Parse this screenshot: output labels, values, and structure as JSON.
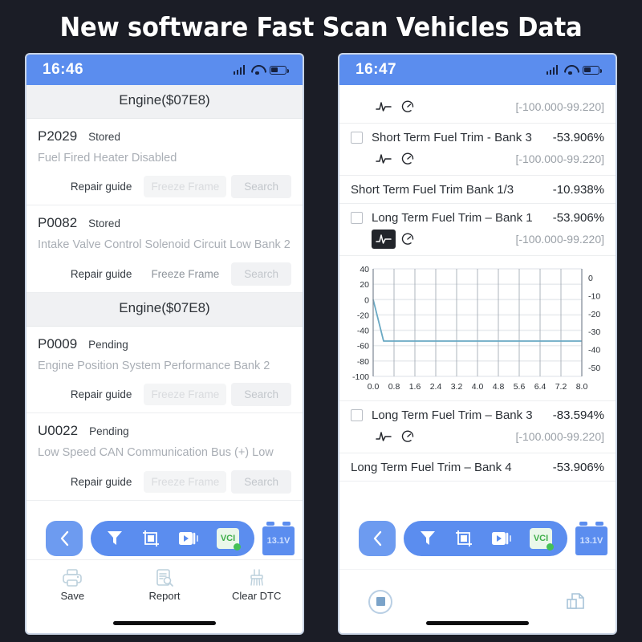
{
  "banner": {
    "title": "New software Fast Scan Vehicles Data"
  },
  "left_phone": {
    "statusbar": {
      "time": "16:46",
      "signal_icon": "signal-bars-icon",
      "wifi_icon": "wifi-icon",
      "battery_icon": "battery-icon"
    },
    "sections": [
      {
        "header": "Engine($07E8)",
        "codes": [
          {
            "code": "P2029",
            "state": "Stored",
            "description": "Fuel Fired Heater Disabled",
            "repair_label": "Repair guide",
            "freeze_label": "Freeze Frame",
            "search_label": "Search",
            "freeze_enabled": false
          },
          {
            "code": "P0082",
            "state": "Stored",
            "description": "Intake Valve Control Solenoid Circuit Low Bank 2",
            "repair_label": "Repair guide",
            "freeze_label": "Freeze Frame",
            "search_label": "Search",
            "freeze_enabled": true
          }
        ]
      },
      {
        "header": "Engine($07E8)",
        "codes": [
          {
            "code": "P0009",
            "state": "Pending",
            "description": "Engine Position System Performance Bank 2",
            "repair_label": "Repair guide",
            "freeze_label": "Freeze Frame",
            "search_label": "Search",
            "freeze_enabled": false
          },
          {
            "code": "U0022",
            "state": "Pending",
            "description": "Low Speed CAN Communication Bus (+) Low",
            "repair_label": "Repair guide",
            "freeze_label": "Freeze Frame",
            "search_label": "Search",
            "freeze_enabled": false
          }
        ]
      }
    ],
    "bottom_bar": [
      {
        "label": "Save",
        "icon": "printer-icon"
      },
      {
        "label": "Report",
        "icon": "report-search-icon"
      },
      {
        "label": "Clear DTC",
        "icon": "broom-icon"
      }
    ],
    "floating_toolbar": {
      "back_icon": "chevron-left-icon",
      "tools": [
        "filter-icon",
        "screenshot-crop-icon",
        "video-record-icon",
        "vci-icon"
      ],
      "vci_label": "VCI",
      "battery_voltage": "13.1V"
    }
  },
  "right_phone": {
    "statusbar": {
      "time": "16:47",
      "signal_icon": "signal-bars-icon",
      "wifi_icon": "wifi-icon",
      "battery_icon": "battery-icon"
    },
    "partial_top_row": {
      "range": "[-100.000-99.220]",
      "wave_icon": "waveform-icon",
      "gauge_icon": "gauge-icon"
    },
    "rows": [
      {
        "name": "Short Term Fuel Trim - Bank 3",
        "value": "-53.906%",
        "range": "[-100.000-99.220]",
        "checkbox": true,
        "wave_active": false,
        "wave_icon": "waveform-icon",
        "gauge_icon": "gauge-icon"
      },
      {
        "name": "Short Term Fuel Trim Bank 1/3",
        "value": "-10.938%",
        "range": "",
        "checkbox": false,
        "wave_active": false
      },
      {
        "name": "Long Term Fuel Trim – Bank 1",
        "value": "-53.906%",
        "range": "[-100.000-99.220]",
        "checkbox": true,
        "wave_active": true,
        "wave_icon": "waveform-icon",
        "gauge_icon": "gauge-icon"
      },
      {
        "name": "Long Term Fuel Trim – Bank 3",
        "value": "-83.594%",
        "range": "[-100.000-99.220]",
        "checkbox": true,
        "wave_active": false,
        "wave_icon": "waveform-icon",
        "gauge_icon": "gauge-icon"
      },
      {
        "name": "Long Term Fuel Trim – Bank 4",
        "value": "-53.906%",
        "range": "",
        "checkbox": false,
        "wave_active": false
      }
    ],
    "bottom_bar": {
      "stop_icon": "stop-record-icon",
      "report_icon": "report-file-icon"
    },
    "floating_toolbar": {
      "back_icon": "chevron-left-icon",
      "tools": [
        "filter-icon",
        "screenshot-crop-icon",
        "video-record-icon",
        "vci-icon"
      ],
      "vci_label": "VCI",
      "battery_voltage": "13.1V"
    }
  },
  "chart_data": {
    "type": "line",
    "title": "",
    "xlabel": "",
    "ylabel": "",
    "line_color": "#6aa9c4",
    "grid": true,
    "legend": "none",
    "x_ticks": [
      "0.0",
      "0.8",
      "1.6",
      "2.4",
      "3.2",
      "4.0",
      "4.8",
      "5.6",
      "6.4",
      "7.2",
      "8.0"
    ],
    "xlim": [
      0.0,
      8.0
    ],
    "y_left_ticks": [
      "40",
      "20",
      "0",
      "-20",
      "-40",
      "-60",
      "-80",
      "-100"
    ],
    "y_left_lim": [
      -100,
      40
    ],
    "y_right_ticks": [
      "0",
      "-10",
      "-20",
      "-30",
      "-40",
      "-50"
    ],
    "y_right_lim": [
      -55,
      5
    ],
    "series": [
      {
        "name": "Long Term Fuel Trim – Bank 1",
        "x": [
          0.0,
          0.4,
          0.8,
          1.6,
          2.4,
          3.2,
          4.0,
          4.8,
          5.6,
          6.4,
          7.2,
          8.0
        ],
        "values": [
          0,
          -54,
          -54,
          -54,
          -54,
          -54,
          -54,
          -54,
          -54,
          -54,
          -54,
          -54
        ]
      }
    ]
  }
}
